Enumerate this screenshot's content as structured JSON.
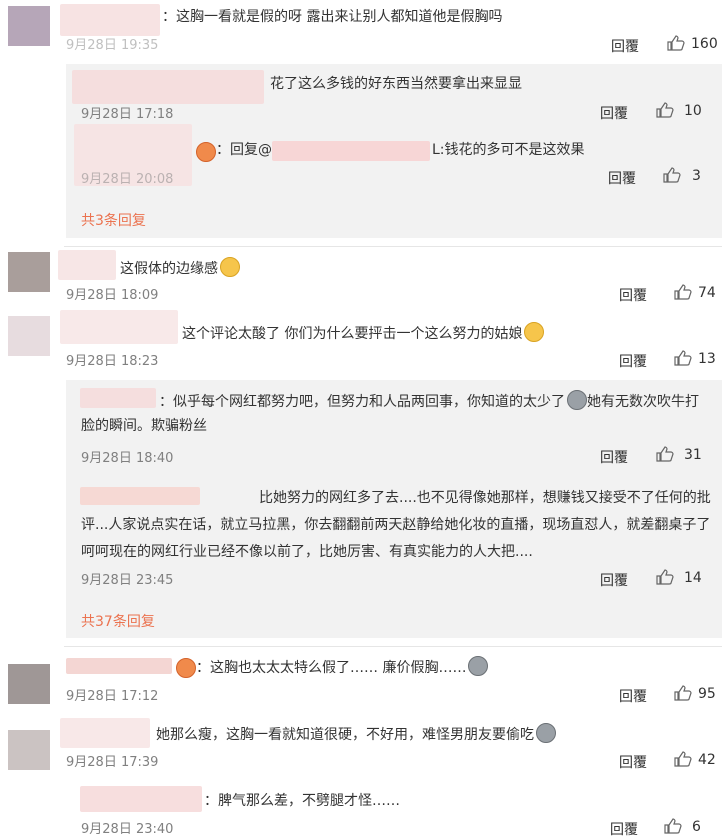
{
  "actions": {
    "reply_label": "回覆"
  },
  "colors": {
    "accent": "#eb7350",
    "time": "#808080",
    "sub_bg": "#f2f2f2"
  },
  "comments": [
    {
      "text": "：这胸一看就是假的呀 露出来让别人都知道他是假胸吗",
      "time": "9月28日 19:35",
      "likes": "160"
    },
    {
      "text": "这假体的边缘感",
      "time": "9月28日 18:09",
      "likes": "74",
      "emoji": "face-thinking-icon"
    },
    {
      "text": "这个评论太酸了 你们为什么要抨击一个这么努力的姑娘",
      "time": "9月28日 18:23",
      "likes": "13",
      "emoji": "face-smirk-icon"
    },
    {
      "text": "：这胸也太太太特么假了…… 廉价假胸……",
      "time": "9月28日 17:12",
      "likes": "95",
      "emoji": "ghost-face-icon"
    },
    {
      "text": "她那么瘦，这胸一看就知道很硬，不好用，难怪男朋友要偷吃",
      "time": "9月28日 17:39",
      "likes": "42",
      "emoji": "ghost-face-icon"
    },
    {
      "text": "：脾气那么差，不劈腿才怪……",
      "time": "9月28日 23:40",
      "likes": "6"
    }
  ],
  "subreplies": [
    {
      "text": "花了这么多钱的好东西当然要拿出来显显",
      "time": "9月28日 17:18",
      "likes": "10"
    },
    {
      "text": "：回复@",
      "text2": "L:钱花的多可不是这效果",
      "time": "9月28日 20:08",
      "likes": "3"
    },
    {
      "text": "：似乎每个网红都努力吧，但努力和人品两回事，你知道的太少了",
      "text2": "她有无数次吹牛打脸的瞬间。欺骗粉丝",
      "time": "9月28日 18:40",
      "likes": "31"
    },
    {
      "text": "比她努力的网红多了去....也不见得像她那样，想赚钱又接受不了任何的批评...人家说点实在话，就立马拉黑，你去翻翻前两天赵静给她化妆的直播，现场直怼人，就差翻桌子了呵呵现在的网红行业已经不像以前了，比她厉害、有真实能力的人大把....",
      "time": "9月28日 23:45",
      "likes": "14"
    }
  ],
  "more_links": [
    "共3条回复",
    "共37条回复"
  ]
}
